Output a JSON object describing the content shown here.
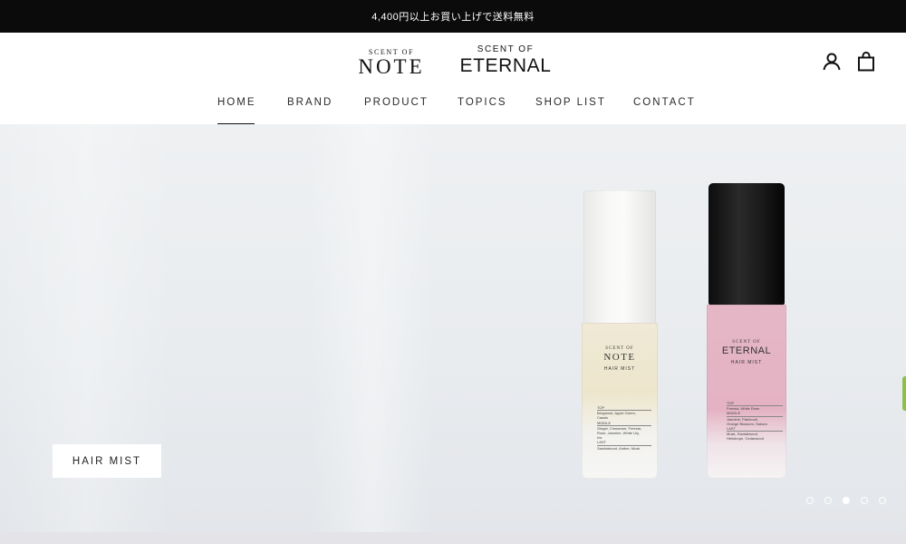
{
  "announcement": {
    "text": "4,400円以上お買い上げで送料無料"
  },
  "logos": {
    "note": {
      "small": "SCENT OF",
      "big": "NOTE"
    },
    "eternal": {
      "small": "SCENT OF",
      "big": "ETERNAL"
    }
  },
  "header_icons": {
    "account": "account-icon",
    "cart": "shopping-bag-icon"
  },
  "nav": {
    "items": [
      {
        "label": "HOME",
        "active": true
      },
      {
        "label": "BRAND"
      },
      {
        "label": "PRODUCT"
      },
      {
        "label": "TOPICS"
      },
      {
        "label": "SHOP LIST"
      },
      {
        "label": "CONTACT"
      }
    ]
  },
  "hero": {
    "tag_label": "HAIR MIST",
    "products": {
      "note": {
        "brand_small": "SCENT OF",
        "brand_big": "NOTE",
        "type": "HAIR MIST",
        "notes": [
          "TOP",
          "Bergamot, Apple Green,",
          "Cassis",
          "MIDDLE",
          "Ginger, Cinnamon, Freesia,",
          "Rose, Jasmine, White Lily,",
          "Iris",
          "LAST",
          "Sandalwood, Amber, Musk"
        ]
      },
      "eternal": {
        "brand_small": "SCENT OF",
        "brand_big": "ETERNAL",
        "type": "HAIR MIST",
        "notes": [
          "TOP",
          "Freesia, White Rose",
          "MIDDLE",
          "Jasmine, Patchouli,",
          "Orange Blossom, Sakura",
          "LAST",
          "Musk, Sandalwood,",
          "Heliotrope, Cedarwood"
        ]
      }
    },
    "slides": {
      "count": 5,
      "active_index": 2
    }
  },
  "colors": {
    "announcement_bg": "#0b0b0b",
    "accent_side": "#8fbf4a",
    "cap_eternal": "#111111",
    "body_eternal": "#e4b2c3",
    "body_note": "#eee6cc"
  }
}
